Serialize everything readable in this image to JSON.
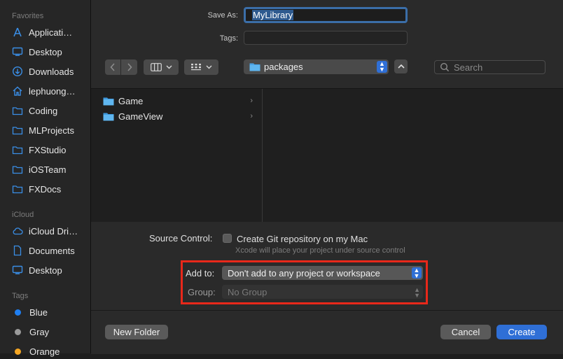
{
  "sidebar": {
    "favorites_title": "Favorites",
    "favorites": [
      {
        "label": "Applicati…",
        "icon": "applications-icon"
      },
      {
        "label": "Desktop",
        "icon": "desktop-icon"
      },
      {
        "label": "Downloads",
        "icon": "downloads-icon"
      },
      {
        "label": "lephuong…",
        "icon": "home-icon"
      },
      {
        "label": "Coding",
        "icon": "folder-icon"
      },
      {
        "label": "MLProjects",
        "icon": "folder-icon"
      },
      {
        "label": "FXStudio",
        "icon": "folder-icon"
      },
      {
        "label": "iOSTeam",
        "icon": "folder-icon"
      },
      {
        "label": "FXDocs",
        "icon": "folder-icon"
      }
    ],
    "icloud_title": "iCloud",
    "icloud": [
      {
        "label": "iCloud Dri…",
        "icon": "cloud-icon"
      },
      {
        "label": "Documents",
        "icon": "document-icon"
      },
      {
        "label": "Desktop",
        "icon": "desktop-icon"
      }
    ],
    "tags_title": "Tags",
    "tags": [
      {
        "label": "Blue",
        "color": "#1f7ff2"
      },
      {
        "label": "Gray",
        "color": "#9a9a9a"
      },
      {
        "label": "Orange",
        "color": "#f5a623"
      }
    ]
  },
  "save": {
    "save_as_label": "Save As:",
    "save_as_value": "MyLibrary",
    "tags_label": "Tags:",
    "tags_value": ""
  },
  "toolbar": {
    "path_folder": "packages",
    "search_placeholder": "Search"
  },
  "browser": {
    "items": [
      {
        "label": "Game"
      },
      {
        "label": "GameView"
      }
    ]
  },
  "options": {
    "source_control_label": "Source Control:",
    "git_checkbox_label": "Create Git repository on my Mac",
    "git_hint": "Xcode will place your project under source control",
    "add_to_label": "Add to:",
    "add_to_value": "Don't add to any project or workspace",
    "group_label": "Group:",
    "group_value": "No Group"
  },
  "footer": {
    "new_folder": "New Folder",
    "cancel": "Cancel",
    "create": "Create"
  },
  "colors": {
    "accent": "#2f6fd6",
    "highlight_border": "#e8281a",
    "folder": "#4aa3e6"
  }
}
